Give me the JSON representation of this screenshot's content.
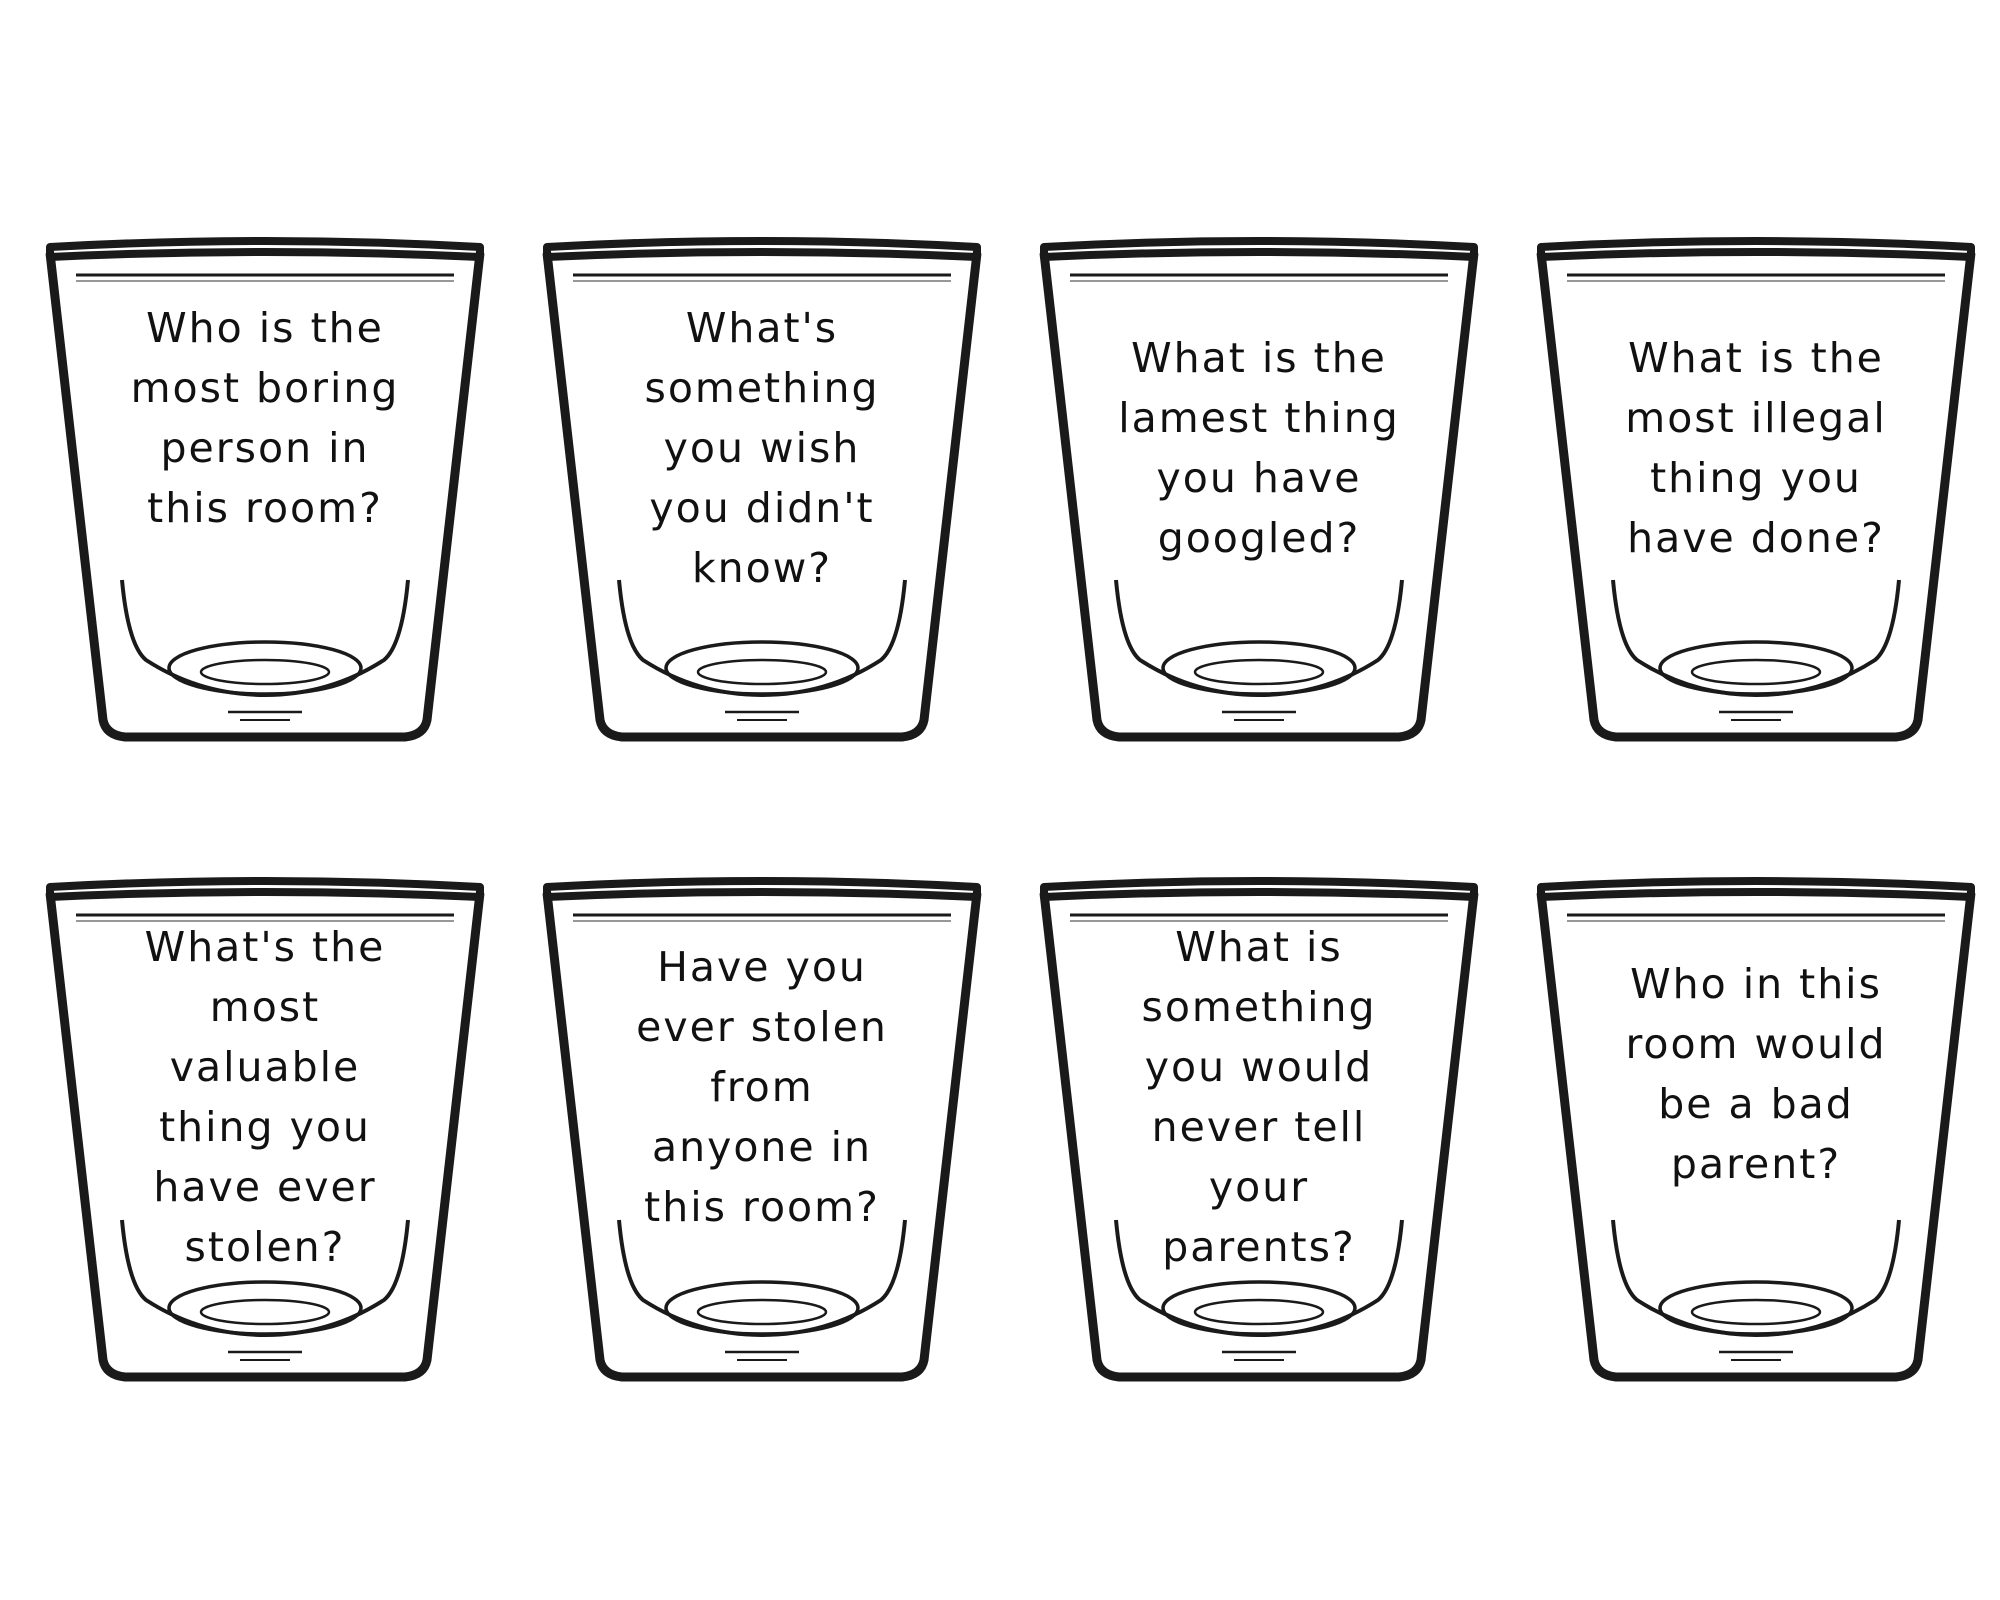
{
  "colors": {
    "outline": "#1a1a1a",
    "text": "#111111",
    "background": "#ffffff"
  },
  "icon": "shot-glass-icon",
  "cards": [
    {
      "lines": [
        "Who is the",
        "most boring",
        "person in",
        "this room?"
      ]
    },
    {
      "lines": [
        "What's",
        "something",
        "you wish",
        "you didn't",
        "know?"
      ]
    },
    {
      "lines": [
        "What is the",
        "lamest thing",
        "you have",
        "googled?"
      ]
    },
    {
      "lines": [
        "What is the",
        "most illegal",
        "thing you",
        "have done?"
      ]
    },
    {
      "lines": [
        "What's the",
        "most",
        "valuable",
        "thing you",
        "have ever",
        "stolen?"
      ]
    },
    {
      "lines": [
        "Have you",
        "ever stolen",
        "from",
        "anyone in",
        "this room?"
      ]
    },
    {
      "lines": [
        "What is",
        "something",
        "you would",
        "never tell",
        "your",
        "parents?"
      ]
    },
    {
      "lines": [
        "Who in this",
        "room would",
        "be a bad",
        "parent?"
      ]
    }
  ]
}
